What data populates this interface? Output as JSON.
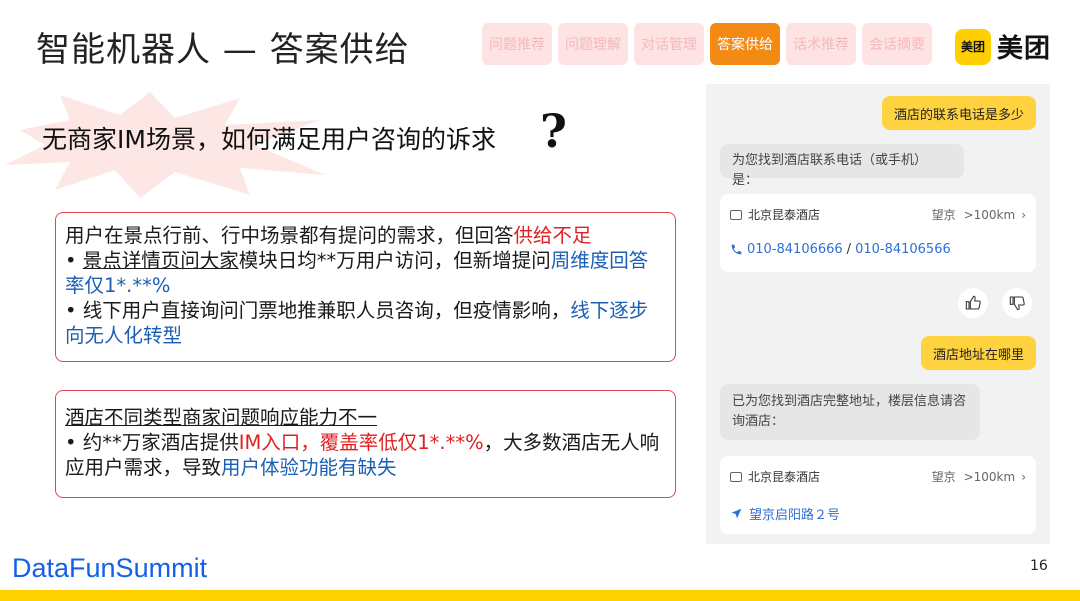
{
  "header": {
    "title": "智能机器人 — 答案供给",
    "tabs": [
      {
        "label": "问题推荐",
        "active": false
      },
      {
        "label": "问题理解",
        "active": false
      },
      {
        "label": "对话管理",
        "active": false
      },
      {
        "label": "答案供给",
        "active": true
      },
      {
        "label": "话术推荐",
        "active": false
      },
      {
        "label": "会话摘要",
        "active": false
      }
    ],
    "logo_badge": "美团",
    "logo_text": "美团"
  },
  "subtitle": "无商家IM场景，如何满足用户咨询的诉求",
  "question_mark": "?",
  "box1": {
    "line1_a": "用户在景点行前、行中场景都有提问的需求，但回答",
    "line1_b": "供给不足",
    "b1_bullet": "• ",
    "b1_u": "景点详情页问大家",
    "b1_mid": "模块日均**万用户访问，但新增提问",
    "b1_blue": "周维度回答率仅1*.**%",
    "b2_a": "• 线下用户直接询问门票地推兼职人员咨询，但疫情影响，",
    "b2_blue": "线下逐步向无人化转型"
  },
  "box2": {
    "heading": "酒店不同类型商家问题响应能力不一",
    "b_a": "• 约**万家酒店提供",
    "b_red": "IM入口，覆盖率低仅1*.**%",
    "b_mid": "，大多数酒店无人响应用户需求，导致",
    "b_blue": "用户体验功能有缺失"
  },
  "chat": {
    "q1": "酒店的联系电话是多少",
    "a1": "为您找到酒店联系电话（或手机）是：",
    "card1": {
      "name": "北京昆泰酒店",
      "area": "望京",
      "dist": ">100km",
      "phone1": "010-84106666",
      "sep": "/",
      "phone2": "010-84106566"
    },
    "q2": "酒店地址在哪里",
    "a2_line1": "已为您找到酒店完整地址，楼层信息请咨",
    "a2_line2": "询酒店：",
    "card2": {
      "name": "北京昆泰酒店",
      "area": "望京",
      "dist": ">100km",
      "address": "望京启阳路２号"
    }
  },
  "footer": {
    "brand": "DataFunSummit",
    "page": "16"
  },
  "colors": {
    "accent_orange": "#f28a14",
    "tab_inactive_bg": "#fde3e3",
    "box_border": "#e0474c",
    "highlight_red": "#e02020",
    "highlight_blue": "#1a5fb4",
    "brand_yellow": "#ffd200",
    "datafun_blue": "#1560e8"
  }
}
